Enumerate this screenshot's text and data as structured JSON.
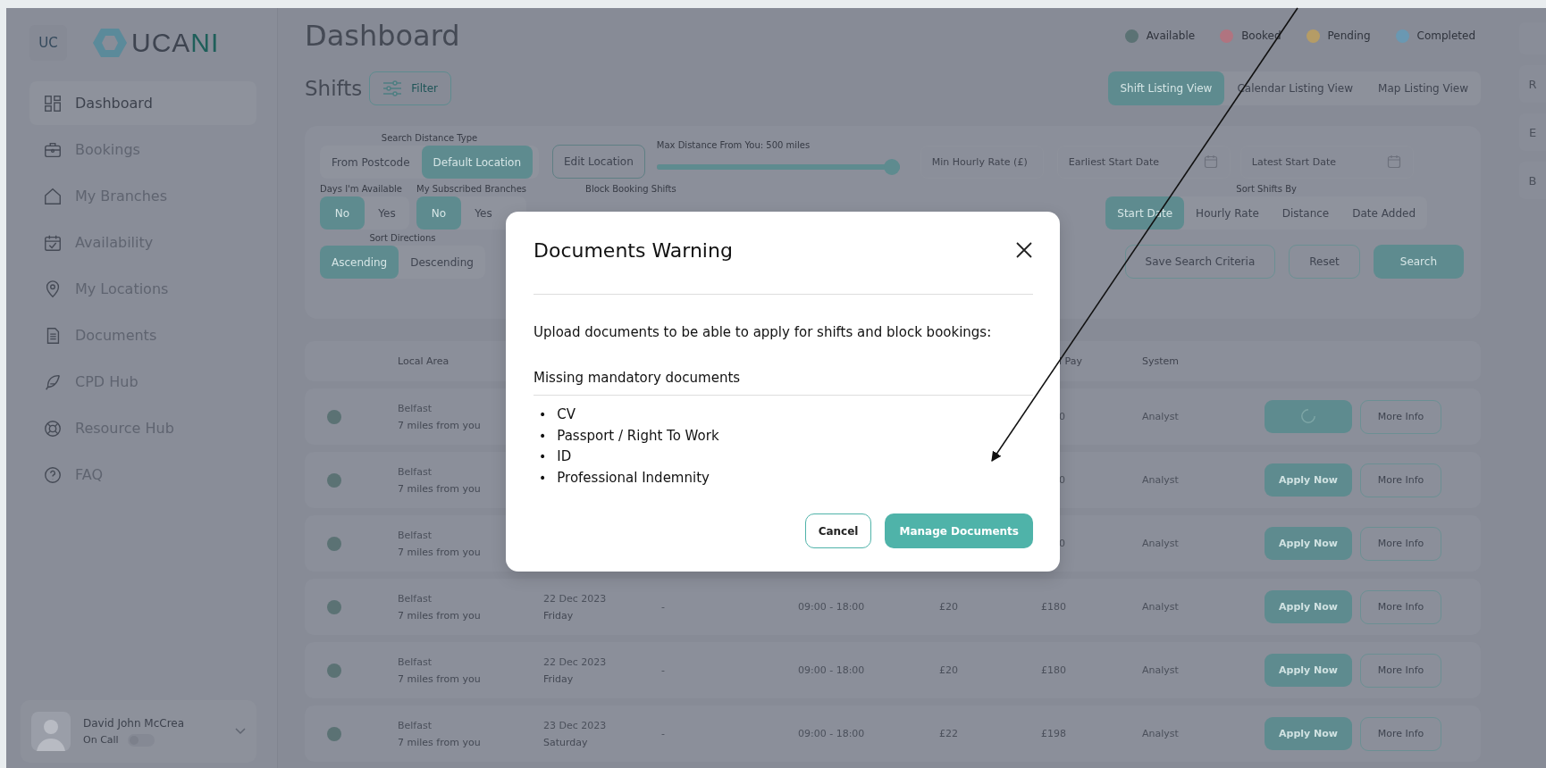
{
  "sidebar": {
    "badge": "UC",
    "logo": {
      "dark": "UCA",
      "accent": "NI"
    },
    "items": [
      {
        "label": "Dashboard",
        "selected": true
      },
      {
        "label": "Bookings",
        "selected": false
      },
      {
        "label": "My Branches",
        "selected": false
      },
      {
        "label": "Availability",
        "selected": false
      },
      {
        "label": "My Locations",
        "selected": false
      },
      {
        "label": "Documents",
        "selected": false
      },
      {
        "label": "CPD Hub",
        "selected": false
      },
      {
        "label": "Resource Hub",
        "selected": false
      },
      {
        "label": "FAQ",
        "selected": false
      }
    ],
    "user": {
      "name": "David John McCrea",
      "status": "On Call",
      "on_call": false
    }
  },
  "header": {
    "title": "Dashboard",
    "legend": [
      {
        "label": "Available",
        "color": "#5b7274"
      },
      {
        "label": "Booked",
        "color": "#b07480"
      },
      {
        "label": "Pending",
        "color": "#b59c66"
      },
      {
        "label": "Completed",
        "color": "#6a98b2"
      }
    ]
  },
  "shifts": {
    "title": "Shifts",
    "filter_button": "Filter",
    "views": [
      {
        "label": "Shift Listing View",
        "selected": true
      },
      {
        "label": "Calendar Listing View",
        "selected": false
      },
      {
        "label": "Map Listing View",
        "selected": false
      }
    ]
  },
  "filters": {
    "distance_type": {
      "label": "Search Distance Type",
      "options": [
        {
          "label": "From Postcode",
          "selected": false
        },
        {
          "label": "Default Location",
          "selected": true
        }
      ]
    },
    "edit_location": "Edit Location",
    "max_distance": {
      "label": "Max Distance From You: 500 miles",
      "level": 1
    },
    "fields": [
      {
        "kind": "text",
        "placeholder": "Min Hourly Rate (£)"
      },
      {
        "kind": "date",
        "placeholder": "Earliest Start Date"
      },
      {
        "kind": "date",
        "placeholder": "Latest Start Date"
      }
    ],
    "days_available": {
      "label": "Days I'm Available",
      "options": [
        {
          "label": "No",
          "selected": true
        },
        {
          "label": "Yes",
          "selected": false
        }
      ]
    },
    "subscribed_branches": {
      "label": "My Subscribed Branches",
      "options": [
        {
          "label": "No",
          "selected": true
        },
        {
          "label": "Yes",
          "selected": false
        }
      ]
    },
    "block_booking_label": "Block Booking Shifts",
    "sort_by": {
      "label": "Sort Shifts By",
      "options": [
        {
          "label": "Start Date",
          "selected": true
        },
        {
          "label": "Hourly Rate",
          "selected": false
        },
        {
          "label": "Distance",
          "selected": false
        },
        {
          "label": "Date Added",
          "selected": false
        }
      ]
    },
    "sort_direction": {
      "label": "Sort Directions",
      "options": [
        {
          "label": "Ascending",
          "selected": true
        },
        {
          "label": "Descending",
          "selected": false
        }
      ]
    },
    "actions": [
      {
        "kind": "outline",
        "label": "Save Search Criteria"
      },
      {
        "kind": "outline",
        "label": "Reset"
      },
      {
        "kind": "primary",
        "label": "Search"
      }
    ]
  },
  "table": {
    "columns": {
      "local_area": "Local Area",
      "total_pay": "l Pay",
      "system": "System"
    },
    "rows": [
      {
        "color": "#5b7274",
        "area": "Belfast",
        "distance": "7 miles from you",
        "total_pay": "0",
        "system": "Analyst",
        "action": {
          "kind": "spinner"
        },
        "more": "More Info"
      },
      {
        "color": "#5b7274",
        "area": "Belfast",
        "distance": "7 miles from you",
        "total_pay": "0",
        "system": "Analyst",
        "action": {
          "kind": "button",
          "label": "Apply Now"
        },
        "more": "More Info"
      },
      {
        "color": "#5b7274",
        "area": "Belfast",
        "distance": "7 miles from you",
        "total_pay": "0",
        "system": "Analyst",
        "action": {
          "kind": "button",
          "label": "Apply Now"
        },
        "more": "More Info"
      },
      {
        "color": "#5b7274",
        "area": "Belfast",
        "distance": "7 miles from you",
        "date": "22 Dec 2023",
        "day": "Friday",
        "break": "-",
        "time": "09:00 - 18:00",
        "rate": "£20",
        "total_pay": "£180",
        "system": "Analyst",
        "action": {
          "kind": "button",
          "label": "Apply Now"
        },
        "more": "More Info"
      },
      {
        "color": "#5b7274",
        "area": "Belfast",
        "distance": "7 miles from you",
        "date": "22 Dec 2023",
        "day": "Friday",
        "break": "-",
        "time": "09:00 - 18:00",
        "rate": "£20",
        "total_pay": "£180",
        "system": "Analyst",
        "action": {
          "kind": "button",
          "label": "Apply Now"
        },
        "more": "More Info"
      },
      {
        "color": "#5b7274",
        "area": "Belfast",
        "distance": "7 miles from you",
        "date": "23 Dec 2023",
        "day": "Saturday",
        "break": "-",
        "time": "09:00 - 18:00",
        "rate": "£22",
        "total_pay": "£198",
        "system": "Analyst",
        "action": {
          "kind": "button",
          "label": "Apply Now"
        },
        "more": "More Info"
      }
    ]
  },
  "right_rail": [
    "R",
    "E",
    "B"
  ],
  "modal": {
    "title": "Documents Warning",
    "message": "Upload documents to be able to apply for shifts and block bookings:",
    "section_title": "Missing mandatory documents",
    "documents": [
      {
        "bullet": "•",
        "label": "CV"
      },
      {
        "bullet": "•",
        "label": "Passport / Right To Work"
      },
      {
        "bullet": "•",
        "label": "ID"
      },
      {
        "bullet": "•",
        "label": "Professional Indemnity"
      }
    ],
    "buttons": [
      {
        "kind": "outline",
        "label": "Cancel"
      },
      {
        "kind": "primary",
        "label": "Manage Documents"
      }
    ]
  }
}
